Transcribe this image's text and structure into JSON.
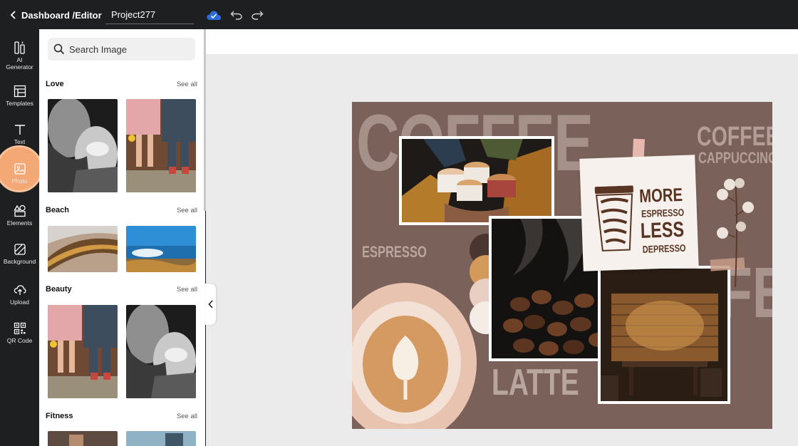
{
  "topbar": {
    "back_label": "Dashboard /Editor",
    "project_name": "Project277"
  },
  "rail": {
    "items": [
      {
        "label": "AI\nGenerator",
        "icon": "ai-generator-icon"
      },
      {
        "label": "Templates",
        "icon": "templates-icon"
      },
      {
        "label": "Text",
        "icon": "text-icon"
      },
      {
        "label": "Photo",
        "icon": "photo-icon"
      },
      {
        "label": "Elements",
        "icon": "elements-icon"
      },
      {
        "label": "Background",
        "icon": "background-icon"
      },
      {
        "label": "Upload",
        "icon": "upload-icon"
      },
      {
        "label": "QR Code",
        "icon": "qr-code-icon"
      }
    ],
    "active": "Photo"
  },
  "panel": {
    "search_placeholder": "Search Image",
    "see_all": "See all",
    "sections": [
      {
        "title": "Love"
      },
      {
        "title": "Beach"
      },
      {
        "title": "Beauty"
      },
      {
        "title": "Fitness"
      }
    ]
  },
  "canvas": {
    "background_color": "#7a625a",
    "texts": {
      "coffee_bg": "COFFEE",
      "coffee": "COFFEE",
      "cappuccino": "CAPPUCCINO",
      "espresso": "ESPRESSO",
      "latte": "LATTE",
      "fe": "FE",
      "more": "MORE",
      "espresso_small": "ESPRESSO",
      "less": "LESS",
      "depresso": "DEPRESSO"
    },
    "swatches": [
      "#4a3530",
      "#d39a5a",
      "#e9cfc3",
      "#f4ece6"
    ]
  }
}
